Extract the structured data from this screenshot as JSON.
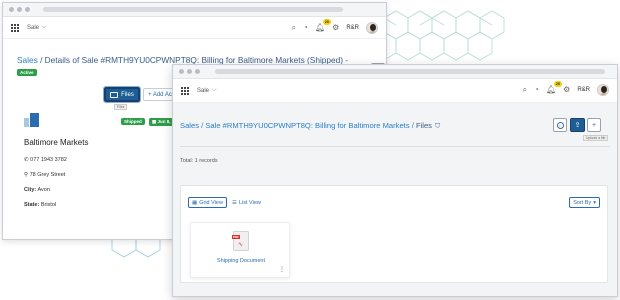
{
  "back_window": {
    "app_name": "Sale",
    "org": "R&R",
    "notif_count": "20",
    "title_crumb": "Sales",
    "title_rest": " / Details of Sale #RMTH9YU0CPWNPT8Q: Billing for Baltimore Markets (Shipped) -",
    "status_pill": "Active",
    "files_button": "Files",
    "files_tooltip": "Files",
    "add_activity_button": "+ Add Acti",
    "card": {
      "status": "Shipped",
      "date": "Jun 8, 2",
      "name": "Baltimore Markets",
      "phone": "077 1943 3782",
      "address": "78 Grey Street",
      "city_label": "City:",
      "city": "Avon",
      "state_label": "State:",
      "state": "Bristol"
    }
  },
  "front_window": {
    "app_name": "Sale",
    "org": "R&R",
    "notif_count": "20",
    "breadcrumb": {
      "sales": "Sales",
      "sep1": " / ",
      "sale": "Sale #RMTH9YU0CPWNPT8Q: Billing for Baltimore Markets",
      "sep2": " / ",
      "current": "Files"
    },
    "upload_tooltip": "Upload a file",
    "total_records": "Total: 1 records",
    "grid_view_label": "Grid View",
    "list_view_label": "List View",
    "sort_by_label": "Sort By",
    "files": [
      {
        "name": "Shipping Document",
        "type": "PDF"
      }
    ]
  },
  "colors": {
    "primary": "#1d5f95",
    "link": "#2a7fc7",
    "success": "#2e9d4a",
    "badge": "#f3d10a"
  }
}
